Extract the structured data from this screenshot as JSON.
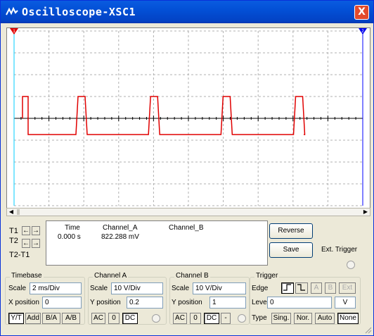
{
  "window": {
    "title": "Oscilloscope-XSC1",
    "close_glyph": "X"
  },
  "colors": {
    "titlebar": "#0a5be0",
    "trace": "#e00000",
    "cursor1": "#00ccff",
    "cursor2": "#0000ff"
  },
  "display": {
    "cursor_t1_marker": "1",
    "cursor_t2_marker": "2",
    "waveform": {
      "channel": "A",
      "high": 1,
      "low": -0.74,
      "period_divisions": 2.08
    }
  },
  "readout": {
    "t1_label": "T1",
    "t2_label": "T2",
    "t2t1_label": "T2-T1",
    "headers": {
      "time": "Time",
      "channel_a": "Channel_A",
      "channel_b": "Channel_B"
    },
    "row_t1": {
      "time": "0.000 s",
      "channel_a": "822.288 mV",
      "channel_b": ""
    }
  },
  "buttons": {
    "reverse": "Reverse",
    "save": "Save",
    "ext_trigger": "Ext. Trigger"
  },
  "timebase": {
    "title": "Timebase",
    "scale_label": "Scale",
    "scale_value": "2 ms/Div",
    "xpos_label": "X position",
    "xpos_value": "0",
    "modes": [
      "Y/T",
      "Add",
      "B/A",
      "A/B"
    ],
    "selected_mode": "Y/T"
  },
  "channel_a": {
    "title": "Channel A",
    "scale_label": "Scale",
    "scale_value": "10  V/Div",
    "ypos_label": "Y position",
    "ypos_value": "0.2",
    "coupling": [
      "AC",
      "0",
      "DC"
    ],
    "selected": "DC"
  },
  "channel_b": {
    "title": "Channel B",
    "scale_label": "Scale",
    "scale_value": "10  V/Div",
    "ypos_label": "Y position",
    "ypos_value": "1",
    "coupling": [
      "AC",
      "0",
      "DC",
      "-"
    ],
    "selected": "DC"
  },
  "trigger": {
    "title": "Trigger",
    "edge_label": "Edge",
    "sources": [
      "A",
      "B",
      "Ext"
    ],
    "level_label": "Level",
    "level_value": "0",
    "level_unit": "V",
    "type_label": "Type",
    "types": [
      "Sing.",
      "Nor.",
      "Auto",
      "None"
    ],
    "selected_type": "None"
  }
}
